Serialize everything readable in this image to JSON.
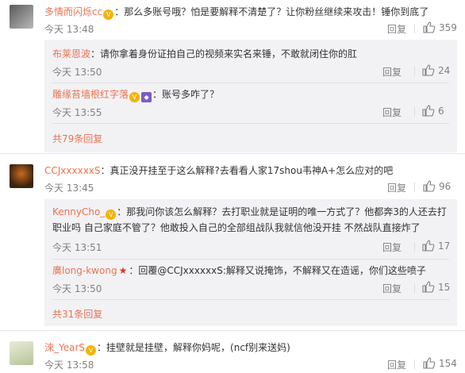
{
  "comments": [
    {
      "user": "多情而闪烁cc",
      "text": "：那么多账号哦？怕是要解释不清楚了？让你粉丝继续来攻击！锤你到底了",
      "time": "今天 13:48",
      "reply": "回复",
      "likes": "359",
      "subs": [
        {
          "user": "布莱恩波",
          "text": "：请你拿着身份证拍自己的视频来实名来锤，不敢就闭住你的肛",
          "time": "今天 13:50",
          "reply": "回复",
          "likes": "24"
        },
        {
          "user": "雕缘苔墙根红字落",
          "text": "：账号多咋了？",
          "time": "今天 13:55",
          "reply": "回复",
          "likes": "6"
        }
      ],
      "more": "共79条回复"
    },
    {
      "user": "CCJxxxxxxS",
      "text": "：真正没开挂至于这么解释?去看看人家17shou韦神A+怎么应对的吧",
      "time": "今天 13:45",
      "reply": "回复",
      "likes": "96",
      "subs": [
        {
          "user": "KennyCho_",
          "text": "：那我问你该怎么解释？去打职业就是证明的唯一方式了？他都奔3的人还去打职业吗 自己家庭不管了？他敢投入自己的全部组战队我就信他没开挂 不然战队直接炸了",
          "time": "今天 13:51",
          "reply": "回复",
          "likes": "17"
        },
        {
          "user": "廣long-kwong",
          "text": "：回覆@CCJxxxxxxS:解释又说掩饰，不解释又在造谣，你们这些喷子",
          "time": "今天 13:50",
          "reply": "回复",
          "likes": "15"
        }
      ],
      "more": "共31条回复"
    },
    {
      "user": "淶_YearS",
      "text": "：挂壁就是挂壁，解释你妈呢，(ncf别来送妈)",
      "time": "今天 13:58",
      "reply": "回复",
      "likes": "154"
    }
  ],
  "icons": {
    "like": "thumbs-up-icon",
    "badge": "vip-badge-icon",
    "crown": "red-star-icon"
  },
  "colors": {
    "username": "#eb7350",
    "meta": "#808080",
    "subbg": "#f2f2f5"
  }
}
